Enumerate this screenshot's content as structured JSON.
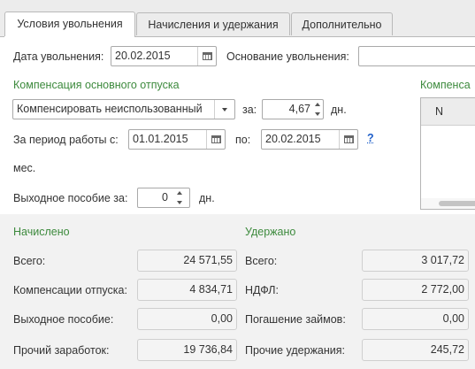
{
  "tabs": [
    {
      "label": "Условия увольнения",
      "active": true
    },
    {
      "label": "Начисления и удержания",
      "active": false
    },
    {
      "label": "Дополнительно",
      "active": false
    }
  ],
  "dismissal": {
    "date_label": "Дата увольнения:",
    "date_value": "20.02.2015",
    "basis_label": "Основание увольнения:",
    "basis_value": ""
  },
  "compensation": {
    "section_title": "Компенсация основного отпуска",
    "mode_value": "Компенсировать неиспользованный",
    "for_label": "за:",
    "days_value": "4,67",
    "days_unit": "дн.",
    "period_label": "За период работы с:",
    "period_from": "01.01.2015",
    "to_label": "по:",
    "period_to": "20.02.2015",
    "help_label": "?",
    "months_label": "мес."
  },
  "severance": {
    "label": "Выходное пособие за:",
    "value": "0",
    "unit": "дн."
  },
  "right_table": {
    "title": "Компенса",
    "column_n": "N"
  },
  "accrued": {
    "title": "Начислено",
    "rows": [
      {
        "label": "Всего:",
        "value": "24 571,55"
      },
      {
        "label": "Компенсации отпуска:",
        "value": "4 834,71"
      },
      {
        "label": "Выходное пособие:",
        "value": "0,00"
      },
      {
        "label": "Прочий заработок:",
        "value": "19 736,84"
      }
    ]
  },
  "withheld": {
    "title": "Удержано",
    "rows": [
      {
        "label": "Всего:",
        "value": "3 017,72"
      },
      {
        "label": "НДФЛ:",
        "value": "2 772,00"
      },
      {
        "label": "Погашение займов:",
        "value": "0,00"
      },
      {
        "label": "Прочие удержания:",
        "value": "245,72"
      }
    ]
  },
  "colors": {
    "section_green": "#3d8a3d",
    "help_blue": "#1f5fc9"
  },
  "icons": {
    "calendar": "calendar-icon",
    "dropdown": "chevron-down-icon",
    "spinner": "spinner-arrows-icon"
  }
}
